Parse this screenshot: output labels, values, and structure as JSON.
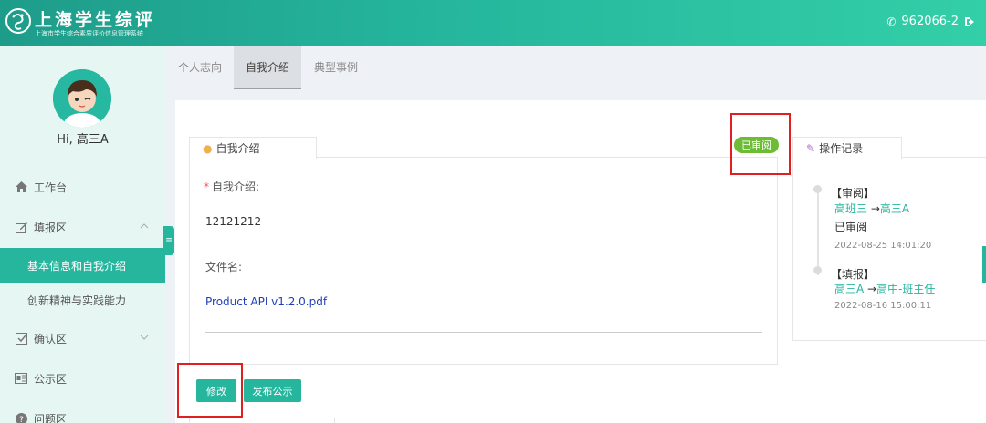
{
  "header": {
    "title": "上海学生综评",
    "subtitle": "上海市学生综合素质评价信息管理系统",
    "hotline": "962066-2",
    "brand_color": "#25b69d"
  },
  "sidebar": {
    "greeting": "Hi, 高三A",
    "items": [
      {
        "label": "工作台",
        "icon": "home-icon"
      },
      {
        "label": "填报区",
        "icon": "edit-icon"
      },
      {
        "label": "基本信息和自我介绍",
        "active": true
      },
      {
        "label": "创新精神与实践能力"
      },
      {
        "label": "确认区",
        "icon": "check-square-icon"
      },
      {
        "label": "公示区",
        "icon": "notice-icon"
      },
      {
        "label": "问题区",
        "icon": "question-icon"
      }
    ]
  },
  "tabs": [
    "个人志向",
    "自我介绍",
    "典型事例"
  ],
  "intro_panel": {
    "title": "自我介绍",
    "field_label": "自我介绍:",
    "field_value": "12121212",
    "file_label": "文件名:",
    "file_name": "Product API v1.2.0.pdf",
    "status_badge": "已审阅",
    "status_color": "#6cbc34"
  },
  "buttons": {
    "edit": "修改",
    "publish": "发布公示"
  },
  "log_panel": {
    "title": "操作记录",
    "entries": [
      {
        "action": "【审阅】",
        "from": "高班三",
        "to": "高三A",
        "status": "已审阅",
        "time": "2022-08-25 14:01:20"
      },
      {
        "action": "【填报】",
        "from": "高三A",
        "to": "高中-班主任",
        "status": "",
        "time": "2022-08-16 15:00:11"
      }
    ]
  }
}
